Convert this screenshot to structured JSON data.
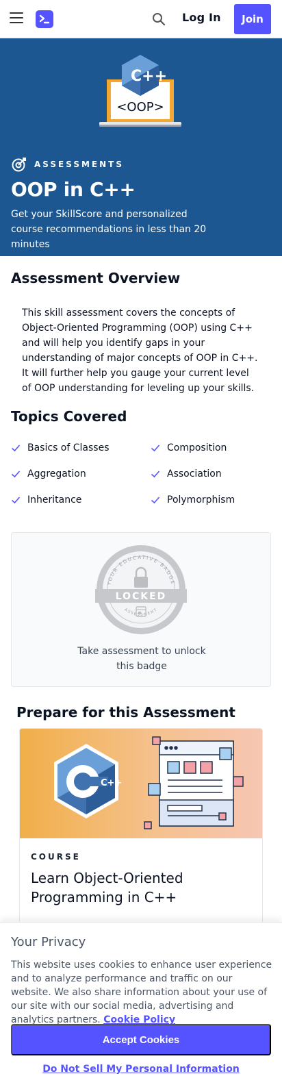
{
  "nav": {
    "login_label": "Log In",
    "join_label": "Join"
  },
  "hero": {
    "tag": "ASSESSMENTS",
    "title": "OOP in C++",
    "subtitle": "Get your SkillScore and personalized course recommendations in less than 20 minutes",
    "illustration_text": "<OOP>",
    "illustration_logo": "C++"
  },
  "overview": {
    "heading": "Assessment Overview",
    "text": "This skill assessment covers the concepts of Object-Oriented Programming (OOP) using C++ and will help you identify gaps in your understanding of major concepts of OOP in C++. It will further help you gauge your current level of OOP understanding for leveling up your skills."
  },
  "topics": {
    "heading": "Topics Covered",
    "items": [
      "Basics of Classes",
      "Composition",
      "Aggregation",
      "Association",
      "Inheritance",
      "Polymorphism"
    ]
  },
  "badge": {
    "ring_text_top": "YOUR EDUCATIVE BADGE",
    "ring_text_bottom": "ASSESSMENT",
    "status": "LOCKED",
    "caption_line1": "Take assessment to unlock",
    "caption_line2": "this badge"
  },
  "prepare": {
    "heading": "Prepare for this Assessment",
    "course": {
      "kicker": "COURSE",
      "title": "Learn Object-Oriented Programming in C++",
      "logo_text": "C++"
    }
  },
  "privacy": {
    "title": "Your Privacy",
    "text": "This website uses cookies to enhance user experience and to analyze performance and traffic on our website. We also share information about your use of our site with our social media, advertising and analytics partners.",
    "policy_link": "Cookie Policy",
    "accept_label": "Accept Cookies",
    "do_not_sell_label": "Do Not Sell My Personal Information"
  },
  "colors": {
    "brand": "#5553ff",
    "hero_bg": "#1c5791",
    "cpp_blue": "#3f72af"
  }
}
